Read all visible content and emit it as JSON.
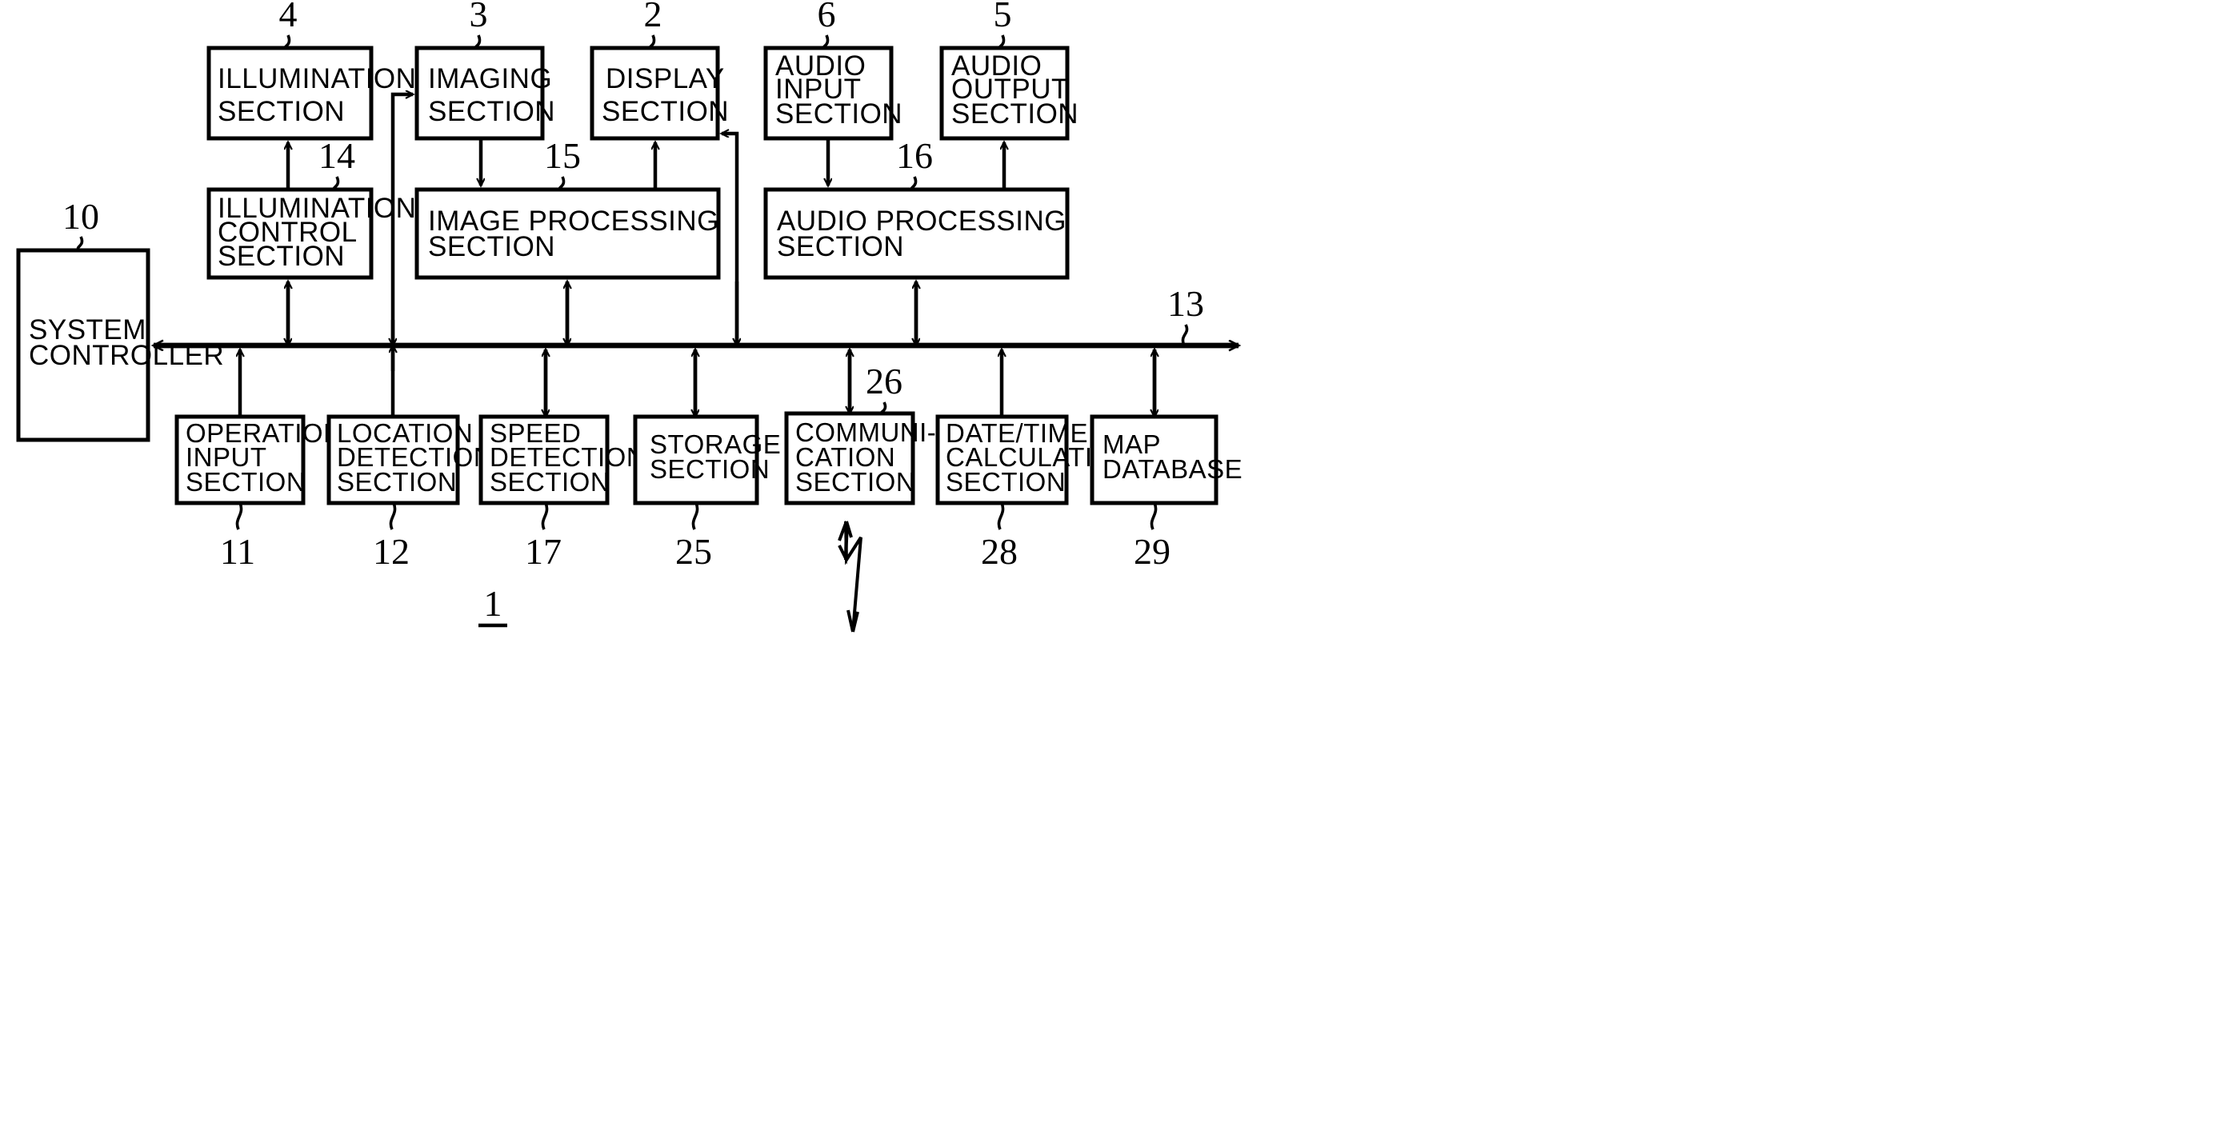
{
  "figure": {
    "ref_label": "1",
    "bus_label": "13"
  },
  "boxes": {
    "illumination_section": {
      "lines": [
        "ILLUMINATION",
        "SECTION"
      ],
      "ref": "4"
    },
    "imaging_section": {
      "lines": [
        "IMAGING",
        "SECTION"
      ],
      "ref": "3"
    },
    "display_section": {
      "lines": [
        "DISPLAY",
        "SECTION"
      ],
      "ref": "2"
    },
    "audio_input_section": {
      "lines": [
        "AUDIO",
        "INPUT",
        "SECTION"
      ],
      "ref": "6"
    },
    "audio_output_section": {
      "lines": [
        "AUDIO",
        "OUTPUT",
        "SECTION"
      ],
      "ref": "5"
    },
    "illumination_control_section": {
      "lines": [
        "ILLUMINATION",
        "CONTROL",
        "SECTION"
      ],
      "ref": "14"
    },
    "image_processing_section": {
      "lines": [
        "IMAGE PROCESSING",
        "SECTION"
      ],
      "ref": "15"
    },
    "audio_processing_section": {
      "lines": [
        "AUDIO PROCESSING",
        "SECTION"
      ],
      "ref": "16"
    },
    "system_controller": {
      "lines": [
        "SYSTEM",
        "CONTROLLER"
      ],
      "ref": "10"
    },
    "operation_input_section": {
      "lines": [
        "OPERATION",
        "INPUT",
        "SECTION"
      ],
      "ref": "11"
    },
    "location_detection_section": {
      "lines": [
        "LOCATION",
        "DETECTION",
        "SECTION"
      ],
      "ref": "12"
    },
    "speed_detection_section": {
      "lines": [
        "SPEED",
        "DETECTION",
        "SECTION"
      ],
      "ref": "17"
    },
    "storage_section": {
      "lines": [
        "STORAGE",
        "SECTION"
      ],
      "ref": "25"
    },
    "communication_section": {
      "lines": [
        "COMMUNI-",
        "CATION",
        "SECTION"
      ],
      "ref": "26"
    },
    "date_time_calculation_section": {
      "lines": [
        "DATE/TIME",
        "CALCULATION",
        "SECTION"
      ],
      "ref": "28"
    },
    "map_database": {
      "lines": [
        "MAP",
        "DATABASE"
      ],
      "ref": "29"
    }
  },
  "colors": {
    "ink": "#000000",
    "paper": "#ffffff"
  }
}
